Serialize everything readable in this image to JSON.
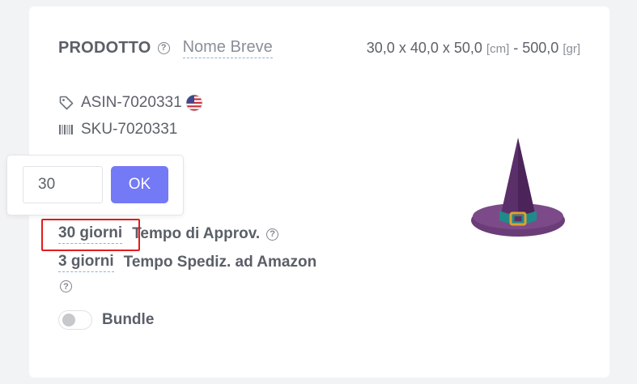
{
  "product": {
    "title": "PRODOTTO",
    "short_name": "Nome Breve",
    "dims_value": "30,0 x 40,0 x 50,0",
    "dims_unit": "[cm]",
    "weight_sep": " - ",
    "weight_value": "500,0",
    "weight_unit": "[gr]"
  },
  "identifiers": {
    "asin": "ASIN-7020331",
    "sku": "SKU-7020331"
  },
  "lead_time": {
    "value": "30 giorni",
    "label": "Tempo di Approv."
  },
  "shipping_time": {
    "value": "3 giorni",
    "label": "Tempo Spediz. ad Amazon"
  },
  "bundle": {
    "label": "Bundle",
    "enabled": false
  },
  "popover": {
    "input_value": "30",
    "ok_label": "OK"
  },
  "colors": {
    "accent": "#7479f6",
    "highlight": "#e11d1d",
    "link_underline": "#8fb0d8"
  },
  "icons": [
    "help-circle-icon",
    "tag-icon",
    "barcode-icon",
    "us-flag-icon",
    "witch-hat-image"
  ]
}
